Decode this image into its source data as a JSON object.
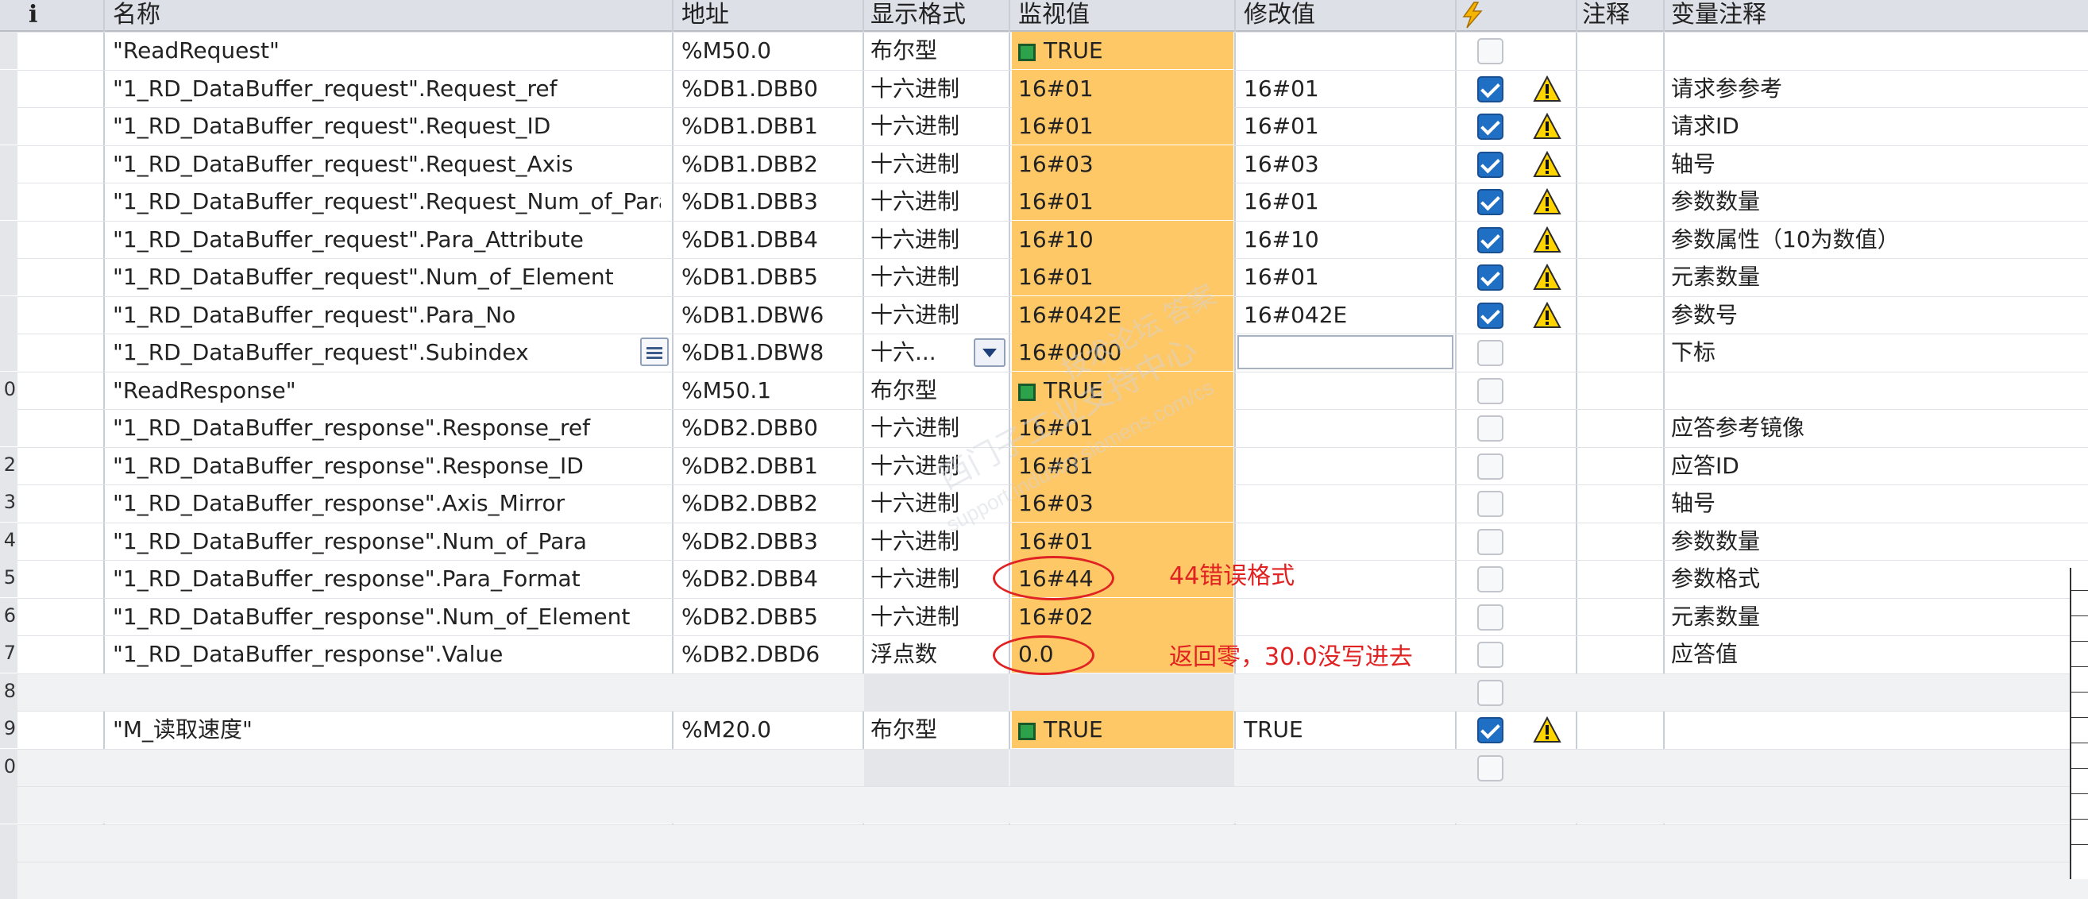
{
  "header": {
    "info": "i",
    "name": "名称",
    "address": "地址",
    "display_format": "显示格式",
    "monitor_value": "监视值",
    "modify_value": "修改值",
    "comment": "注释",
    "tag_comment": "变量注释"
  },
  "rows": [
    {
      "num": "",
      "name": "\"ReadRequest\"",
      "address": "%M50.0",
      "format": "布尔型",
      "monitor": "TRUE",
      "monitor_bool": true,
      "modify": "",
      "checked": false,
      "warn": false,
      "comment": ""
    },
    {
      "num": "",
      "name": "\"1_RD_DataBuffer_request\".Request_ref",
      "address": "%DB1.DBB0",
      "format": "十六进制",
      "monitor": "16#01",
      "monitor_bool": false,
      "modify": "16#01",
      "checked": true,
      "warn": true,
      "comment": "请求参参考"
    },
    {
      "num": "",
      "name": "\"1_RD_DataBuffer_request\".Request_ID",
      "address": "%DB1.DBB1",
      "format": "十六进制",
      "monitor": "16#01",
      "monitor_bool": false,
      "modify": "16#01",
      "checked": true,
      "warn": true,
      "comment": "请求ID"
    },
    {
      "num": "",
      "name": "\"1_RD_DataBuffer_request\".Request_Axis",
      "address": "%DB1.DBB2",
      "format": "十六进制",
      "monitor": "16#03",
      "monitor_bool": false,
      "modify": "16#03",
      "checked": true,
      "warn": true,
      "comment": "轴号"
    },
    {
      "num": "",
      "name": "\"1_RD_DataBuffer_request\".Request_Num_of_Para",
      "address": "%DB1.DBB3",
      "format": "十六进制",
      "monitor": "16#01",
      "monitor_bool": false,
      "modify": "16#01",
      "checked": true,
      "warn": true,
      "comment": "参数数量"
    },
    {
      "num": "",
      "name": "\"1_RD_DataBuffer_request\".Para_Attribute",
      "address": "%DB1.DBB4",
      "format": "十六进制",
      "monitor": "16#10",
      "monitor_bool": false,
      "modify": "16#10",
      "checked": true,
      "warn": true,
      "comment": "参数属性（10为数值）"
    },
    {
      "num": "",
      "name": "\"1_RD_DataBuffer_request\".Num_of_Element",
      "address": "%DB1.DBB5",
      "format": "十六进制",
      "monitor": "16#01",
      "monitor_bool": false,
      "modify": "16#01",
      "checked": true,
      "warn": true,
      "comment": "元素数量"
    },
    {
      "num": "",
      "name": "\"1_RD_DataBuffer_request\".Para_No",
      "address": "%DB1.DBW6",
      "format": "十六进制",
      "monitor": "16#042E",
      "monitor_bool": false,
      "modify": "16#042E",
      "checked": true,
      "warn": true,
      "comment": "参数号"
    },
    {
      "num": "",
      "name": "\"1_RD_DataBuffer_request\".Subindex",
      "address": "%DB1.DBW8",
      "format": "十六...",
      "monitor": "16#0000",
      "monitor_bool": false,
      "modify": "",
      "checked": false,
      "warn": false,
      "comment": "下标",
      "editing": true
    },
    {
      "num": "0",
      "name": "\"ReadResponse\"",
      "address": "%M50.1",
      "format": "布尔型",
      "monitor": "TRUE",
      "monitor_bool": true,
      "modify": "",
      "checked": false,
      "warn": false,
      "comment": ""
    },
    {
      "num": "",
      "name": "\"1_RD_DataBuffer_response\".Response_ref",
      "address": "%DB2.DBB0",
      "format": "十六进制",
      "monitor": "16#01",
      "monitor_bool": false,
      "modify": "",
      "checked": false,
      "warn": false,
      "comment": "应答参考镜像"
    },
    {
      "num": "2",
      "name": "\"1_RD_DataBuffer_response\".Response_ID",
      "address": "%DB2.DBB1",
      "format": "十六进制",
      "monitor": "16#81",
      "monitor_bool": false,
      "modify": "",
      "checked": false,
      "warn": false,
      "comment": "应答ID"
    },
    {
      "num": "3",
      "name": "\"1_RD_DataBuffer_response\".Axis_Mirror",
      "address": "%DB2.DBB2",
      "format": "十六进制",
      "monitor": "16#03",
      "monitor_bool": false,
      "modify": "",
      "checked": false,
      "warn": false,
      "comment": "轴号"
    },
    {
      "num": "4",
      "name": "\"1_RD_DataBuffer_response\".Num_of_Para",
      "address": "%DB2.DBB3",
      "format": "十六进制",
      "monitor": "16#01",
      "monitor_bool": false,
      "modify": "",
      "checked": false,
      "warn": false,
      "comment": "参数数量"
    },
    {
      "num": "5",
      "name": "\"1_RD_DataBuffer_response\".Para_Format",
      "address": "%DB2.DBB4",
      "format": "十六进制",
      "monitor": "16#44",
      "monitor_bool": false,
      "modify": "",
      "checked": false,
      "warn": false,
      "comment": "参数格式"
    },
    {
      "num": "6",
      "name": "\"1_RD_DataBuffer_response\".Num_of_Element",
      "address": "%DB2.DBB5",
      "format": "十六进制",
      "monitor": "16#02",
      "monitor_bool": false,
      "modify": "",
      "checked": false,
      "warn": false,
      "comment": "元素数量"
    },
    {
      "num": "7",
      "name": "\"1_RD_DataBuffer_response\".Value",
      "address": "%DB2.DBD6",
      "format": "浮点数",
      "monitor": "0.0",
      "monitor_bool": false,
      "modify": "",
      "checked": false,
      "warn": false,
      "comment": "应答值"
    },
    {
      "num": "8",
      "empty": true,
      "checked": false
    },
    {
      "num": "9",
      "name": "\"M_读取速度\"",
      "address": "%M20.0",
      "format": "布尔型",
      "monitor": "TRUE",
      "monitor_bool": true,
      "modify": "TRUE",
      "checked": true,
      "warn": true,
      "comment": ""
    },
    {
      "num": "0",
      "empty": true,
      "checked": false
    },
    {
      "num": "",
      "empty": true,
      "blank": true
    },
    {
      "num": "",
      "empty": true,
      "blank": true
    },
    {
      "num": "",
      "empty": true,
      "blank": true
    }
  ],
  "annotations": {
    "format_error": "44错误格式",
    "value_error": "返回零，30.0没写进去"
  },
  "watermark": {
    "text1": "西门子工业支持中心",
    "text2": "support.industry.siemens.com/cs",
    "text3": "技术论坛 答案"
  },
  "colors": {
    "monitor_bg": "#ffc867",
    "annotation": "#e02222",
    "checkbox_on": "#1f6fc4"
  }
}
